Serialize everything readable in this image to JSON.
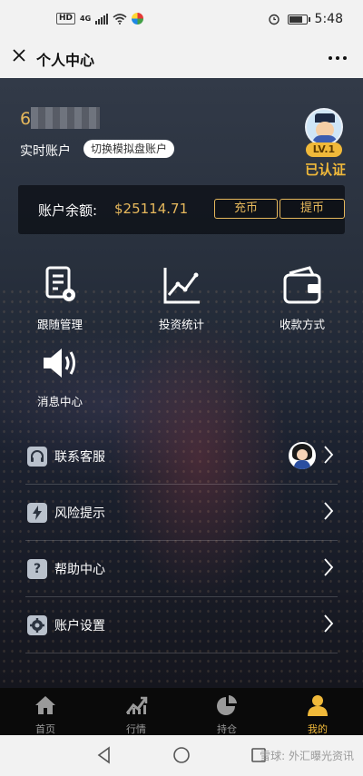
{
  "status_bar": {
    "hd_label": "HD",
    "network_label": "4G",
    "time": "5:48"
  },
  "nav": {
    "close_icon": "close-icon",
    "title": "个人中心",
    "more_label": "•••"
  },
  "profile": {
    "account_number_visible": "6",
    "real_account_label": "实时账户",
    "switch_button_label": "切换模拟盘账户",
    "level_badge": "LV.1",
    "verified_label": "已认证"
  },
  "balance": {
    "label": "账户余额:",
    "value": "$25114.71",
    "deposit_label": "充币",
    "withdraw_label": "提币"
  },
  "grid": [
    {
      "label": "跟随管理",
      "icon": "document-gear-icon"
    },
    {
      "label": "投资统计",
      "icon": "line-chart-icon"
    },
    {
      "label": "收款方式",
      "icon": "wallet-icon"
    },
    {
      "label": "消息中心",
      "icon": "speaker-icon"
    }
  ],
  "menu": [
    {
      "label": "联系客服",
      "icon": "headset-icon"
    },
    {
      "label": "风险提示",
      "icon": "lightning-icon"
    },
    {
      "label": "帮助中心",
      "icon": "question-icon"
    },
    {
      "label": "账户设置",
      "icon": "settings-icon"
    }
  ],
  "tabbar": [
    {
      "label": "首页",
      "icon": "home-icon",
      "active": false
    },
    {
      "label": "行情",
      "icon": "market-chart-icon",
      "active": false
    },
    {
      "label": "持仓",
      "icon": "pie-chart-icon",
      "active": false
    },
    {
      "label": "我的",
      "icon": "user-icon",
      "active": true
    }
  ],
  "watermark": "雪球: 外汇曝光资讯",
  "colors": {
    "accent_gold": "#e6b85c",
    "badge_gold": "#f0b93a"
  }
}
